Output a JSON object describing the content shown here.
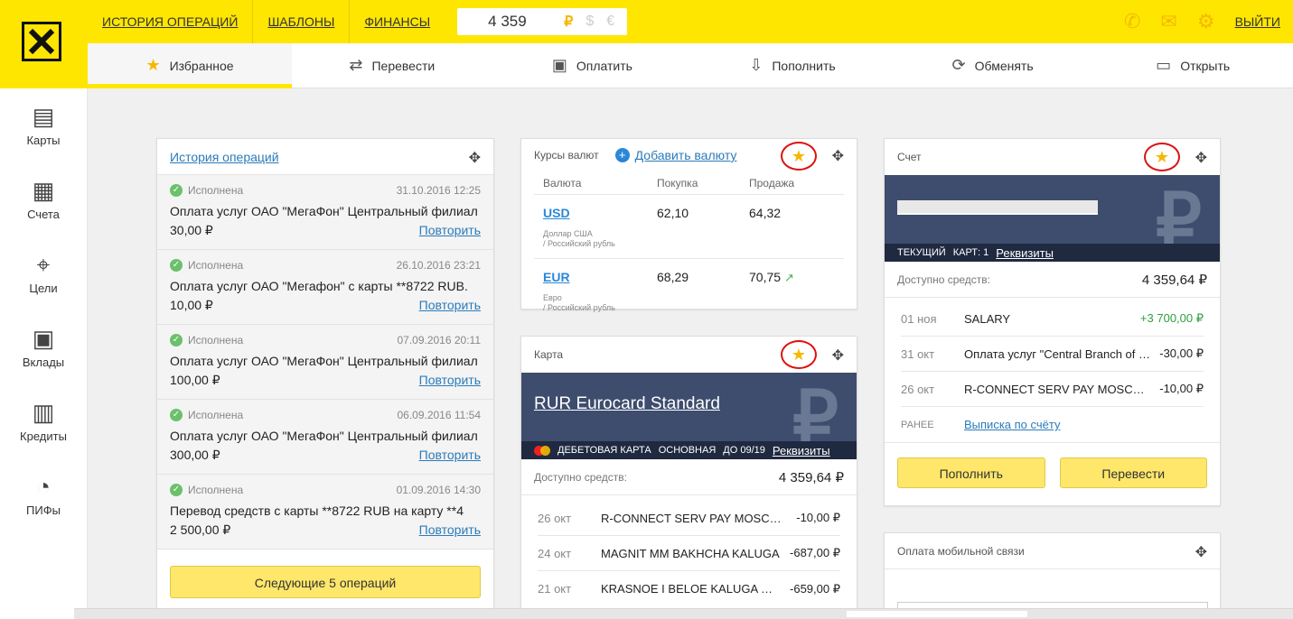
{
  "topnav": {
    "history": "ИСТОРИЯ ОПЕРАЦИЙ",
    "templates": "ШАБЛОНЫ",
    "finance": "ФИНАНСЫ",
    "balance": "4 359",
    "currencies": [
      "₽",
      "$",
      "€"
    ],
    "exit": "ВЫЙТИ",
    "icons": [
      "phone-icon",
      "mail-icon",
      "gear-icon"
    ]
  },
  "actions": [
    {
      "label": "Избранное",
      "icon": "star-icon"
    },
    {
      "label": "Перевести",
      "icon": "transfer-icon"
    },
    {
      "label": "Оплатить",
      "icon": "pay-icon"
    },
    {
      "label": "Пополнить",
      "icon": "topup-icon"
    },
    {
      "label": "Обменять",
      "icon": "exchange-icon"
    },
    {
      "label": "Открыть",
      "icon": "open-icon"
    }
  ],
  "sidebar": [
    {
      "label": "Карты",
      "icon": "cards-icon"
    },
    {
      "label": "Счета",
      "icon": "accounts-icon"
    },
    {
      "label": "Цели",
      "icon": "target-icon"
    },
    {
      "label": "Вклады",
      "icon": "safe-icon"
    },
    {
      "label": "Кредиты",
      "icon": "credit-icon"
    },
    {
      "label": "ПИФы",
      "icon": "pie-icon"
    }
  ],
  "history": {
    "title": "История операций",
    "items": [
      {
        "status": "Исполнена",
        "date": "31.10.2016 12:25",
        "desc": "Оплата услуг ОАО \"МегаФон\" Центральный филиал",
        "amount": "30,00 ₽",
        "repeat": "Повторить"
      },
      {
        "status": "Исполнена",
        "date": "26.10.2016 23:21",
        "desc": "Оплата услуг ОАО \"Мегафон\" с карты **8722 RUB.",
        "amount": "10,00 ₽",
        "repeat": "Повторить"
      },
      {
        "status": "Исполнена",
        "date": "07.09.2016 20:11",
        "desc": "Оплата услуг ОАО \"МегаФон\" Центральный филиал",
        "amount": "100,00 ₽",
        "repeat": "Повторить"
      },
      {
        "status": "Исполнена",
        "date": "06.09.2016 11:54",
        "desc": "Оплата услуг ОАО \"МегаФон\" Центральный филиал",
        "amount": "300,00 ₽",
        "repeat": "Повторить"
      },
      {
        "status": "Исполнена",
        "date": "01.09.2016 14:30",
        "desc": "Перевод средств с карты **8722 RUB на карту **4",
        "amount": "2 500,00 ₽",
        "repeat": "Повторить"
      }
    ],
    "next_button": "Следующие 5 операций"
  },
  "rates": {
    "title": "Курсы валют",
    "add": "Добавить валюту",
    "cols": [
      "Валюта",
      "Покупка",
      "Продажа"
    ],
    "rows": [
      {
        "code": "USD",
        "sub1": "Доллар США",
        "sub2": "/ Российский рубль",
        "buy": "62,10",
        "sell": "64,32",
        "trend": ""
      },
      {
        "code": "EUR",
        "sub1": "Евро",
        "sub2": "/ Российский рубль",
        "buy": "68,29",
        "sell": "70,75",
        "trend": "↗"
      }
    ]
  },
  "card": {
    "title": "Карта",
    "name": "RUR Eurocard Standard",
    "strip": [
      "ДЕБЕТОВАЯ КАРТА",
      "ОСНОВНАЯ",
      "ДО 09/19"
    ],
    "details": "Реквизиты",
    "avail_label": "Доступно средств:",
    "avail_value": "4 359,64 ₽",
    "tx": [
      {
        "date": "26 окт",
        "name": "R-CONNECT SERV PAY MOSCOW",
        "amount": "-10,00 ₽"
      },
      {
        "date": "24 окт",
        "name": "MAGNIT MM BAKHCHA KALUGA",
        "amount": "-687,00 ₽"
      },
      {
        "date": "21 окт",
        "name": "KRASNOE I BELOE KALUGA RUS",
        "amount": "-659,00 ₽"
      }
    ]
  },
  "account": {
    "title": "Счет",
    "strip": [
      "ТЕКУЩИЙ",
      "КАРТ: 1"
    ],
    "details": "Реквизиты",
    "avail_label": "Доступно средств:",
    "avail_value": "4 359,64 ₽",
    "tx": [
      {
        "date": "01 ноя",
        "name": "SALARY",
        "amount": "+3 700,00 ₽"
      },
      {
        "date": "31 окт",
        "name": "Оплата услуг \"Central Branch of PJSC MegaFon\"",
        "amount": "-30,00 ₽"
      },
      {
        "date": "26 окт",
        "name": "R-CONNECT SERV PAY MOSCOW",
        "amount": "-10,00 ₽"
      }
    ],
    "earlier": "РАНЕЕ",
    "statement": "Выписка по счёту",
    "btn_topup": "Пополнить",
    "btn_transfer": "Перевести"
  },
  "mobile": {
    "title": "Оплата мобильной связи"
  }
}
